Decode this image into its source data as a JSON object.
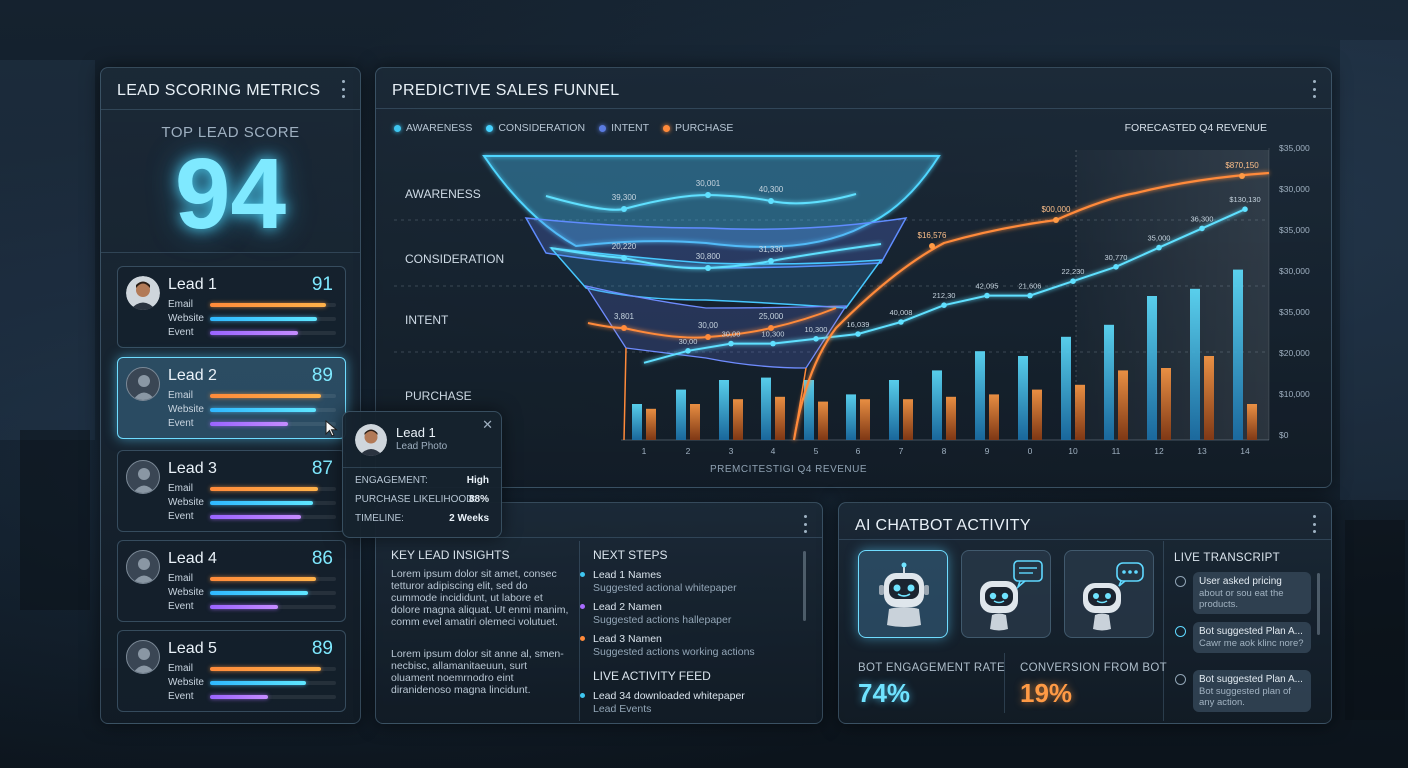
{
  "lead_scoring": {
    "title": "LEAD SCORING METRICS",
    "top_label": "TOP LEAD SCORE",
    "top_score": "94",
    "metric_labels": [
      "Email",
      "Website",
      "Event"
    ],
    "leads": [
      {
        "name": "Lead 1",
        "score": "91",
        "photo": true,
        "email": 0.92,
        "website": 0.85,
        "event": 0.7
      },
      {
        "name": "Lead 2",
        "score": "89",
        "photo": false,
        "email": 0.88,
        "website": 0.84,
        "event": 0.62,
        "selected": true
      },
      {
        "name": "Lead 3",
        "score": "87",
        "photo": false,
        "email": 0.86,
        "website": 0.82,
        "event": 0.72
      },
      {
        "name": "Lead 4",
        "score": "86",
        "photo": false,
        "email": 0.84,
        "website": 0.78,
        "event": 0.54
      },
      {
        "name": "Lead 5",
        "score": "89",
        "photo": false,
        "email": 0.88,
        "website": 0.76,
        "event": 0.46
      }
    ]
  },
  "tooltip": {
    "name": "Lead 1",
    "sub": "Lead Photo",
    "rows": [
      {
        "label": "ENGAGEMENT:",
        "value": "High"
      },
      {
        "label": "PURCHASE LIKELIHOOD:",
        "value": "88%"
      },
      {
        "label": "TIMELINE:",
        "value": "2 Weeks"
      }
    ]
  },
  "funnel": {
    "title": "PREDICTIVE SALES FUNNEL",
    "forecast_title": "FORECASTED Q4 REVENUE",
    "x_caption": "PREMCITESTIGI Q4 REVENUE",
    "legend": [
      {
        "label": "AWARENESS",
        "color": "#3ec6f0"
      },
      {
        "label": "CONSIDERATION",
        "color": "#46d2ff"
      },
      {
        "label": "INTENT",
        "color": "#5a7be0"
      },
      {
        "label": "PURCHASE",
        "color": "#ff8a3a"
      }
    ],
    "stages": [
      "AWARENESS",
      "CONSIDERATION",
      "INTENT",
      "PURCHASE"
    ],
    "y_ticks": [
      "$35,000",
      "$30,000",
      "$35,000",
      "$30,000",
      "$35,000",
      "$20,000",
      "$10,000",
      "$0"
    ]
  },
  "chart_data": {
    "type": "line",
    "x": [
      "1",
      "2",
      "3",
      "4",
      "5",
      "6",
      "7",
      "8",
      "9",
      "0",
      "10",
      "11",
      "12",
      "13",
      "14"
    ],
    "funnel_point_labels": {
      "awareness": [
        "39,300",
        "30,001",
        "40,300"
      ],
      "consideration": [
        "20,220",
        "30,800",
        "31,330"
      ],
      "intent": [
        "3,801",
        "30,00",
        "25,000"
      ]
    },
    "blue_line_labels": [
      "30,00",
      "30,00",
      "10,300",
      "10,300",
      "16,039",
      "40,008",
      "212,30",
      "42,095",
      "21,606",
      "22,230",
      "30,770",
      "35,000",
      "36,300",
      "$130,130"
    ],
    "orange_line_labels": [
      "$16,576",
      "$00,000",
      "$870,150"
    ],
    "series": [
      {
        "name": "AWARENESS",
        "values": [
          0.2,
          0.5,
          0.5,
          0.2
        ]
      },
      {
        "name": "PURCHASE",
        "values": [
          0.25,
          0.35,
          0.45,
          0.6,
          0.62,
          0.62,
          0.62,
          0.63,
          0.7,
          0.76,
          0.8,
          0.84,
          0.86,
          0.88,
          0.94
        ]
      },
      {
        "name": "CONSIDERATION",
        "values": [
          0.28,
          0.33,
          0.36,
          0.36,
          0.38,
          0.4,
          0.45,
          0.52,
          0.56,
          0.56,
          0.62,
          0.68,
          0.76,
          0.84,
          0.92
        ]
      }
    ],
    "bars_blue": [
      0.15,
      0.21,
      0.25,
      0.26,
      0.25,
      0.19,
      0.25,
      0.29,
      0.37,
      0.35,
      0.43,
      0.48,
      0.6,
      0.63,
      0.71
    ],
    "bars_orange": [
      0.13,
      0.15,
      0.17,
      0.18,
      0.16,
      0.17,
      0.17,
      0.18,
      0.19,
      0.21,
      0.23,
      0.29,
      0.3,
      0.35,
      0.15
    ]
  },
  "insights": {
    "key_title": "KEY LEAD INSIGHTS",
    "key_p1": "Lorem ipsum dolor sit amet, consec tetturor adipiscing elit, sed do cummode incididunt, ut labore et dolore magna aliquat. Ut enmi manim, comm evel amatiri olemeci volutuet.",
    "key_p2": "Lorem ipsum dolor sit anne al, smen- necbisc, allamanitaeuun, surt oluament noemrnodro eint diranidenoso magna lincidunt.",
    "next_title": "NEXT STEPS",
    "steps": [
      {
        "name": "Lead 1 Names",
        "desc": "Suggested actional whitepaper",
        "color": "#3ec6f0"
      },
      {
        "name": "Lead 2 Namen",
        "desc": "Suggested actions hallepaper",
        "color": "#a86bff"
      },
      {
        "name": "Lead 3 Namen",
        "desc": "Suggested actions working actions",
        "color": "#ff8a3a"
      }
    ],
    "feed_title": "LIVE ACTIVITY FEED",
    "feed": {
      "name": "Lead 34 downloaded whitepaper",
      "desc": "Lead Events",
      "color": "#3ec6f0"
    }
  },
  "chatbot": {
    "title": "AI CHATBOT ACTIVITY",
    "engagement_label": "BOT ENGAGEMENT RATE",
    "engagement_value": "74%",
    "conversion_label": "CONVERSION FROM BOT",
    "conversion_value": "19%",
    "transcript_title": "LIVE TRANSCRIPT",
    "messages": [
      {
        "line1": "User asked pricing",
        "line2": "about or sou eat the products."
      },
      {
        "line1": "Bot suggested Plan A...",
        "line2": "Cawr me aok klinc nore?"
      },
      {
        "line1": "Bot suggested Plan A...",
        "line2": "Bot suggested plan of any action."
      }
    ]
  }
}
